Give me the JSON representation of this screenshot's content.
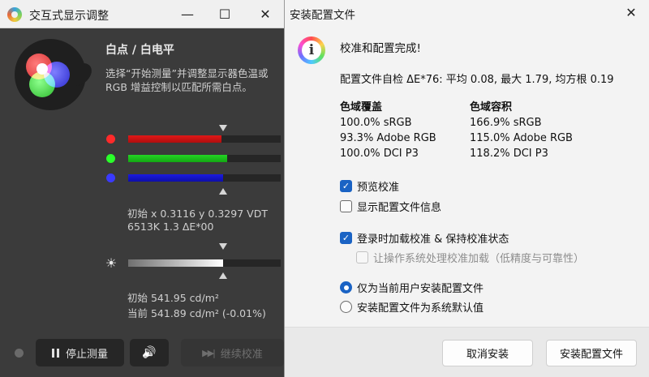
{
  "left_window": {
    "title": "交互式显示调整",
    "minimize_glyph": "—",
    "maximize_glyph": "☐",
    "close_glyph": "✕",
    "section_title": "白点 / 白电平",
    "description": "选择“开始测量”并调整显示器色温或\nRGB 增益控制以匹配所需白点。",
    "channels": [
      {
        "name": "red",
        "color": "#ff2a2a",
        "level_percent": 61
      },
      {
        "name": "green",
        "color": "#2aff2a",
        "level_percent": 65
      },
      {
        "name": "blue",
        "color": "#3a3aff",
        "level_percent": 62
      }
    ],
    "initial_xy": "初始 x 0.3116 y 0.3297 VDT",
    "initial_cct": "6513K 1.3 ΔE*00",
    "sun_icon": "☀",
    "luminance_level_percent": 62,
    "lum_initial": "初始 541.95 cd/m²",
    "lum_current": "当前 541.89 cd/m² (-0.01%)",
    "buttons": {
      "stop": "停止测量",
      "sound_icon": "🔊",
      "continue_icon": "▶▶|",
      "continue": "继续校准"
    }
  },
  "right_dialog": {
    "title": "安装配置文件",
    "close_glyph": "✕",
    "info_glyph": "i",
    "done_text": "校准和配置完成!",
    "selfcheck": "配置文件自检 ΔE*76: 平均 0.08, 最大 1.79, 均方根 0.19",
    "gamut_coverage": {
      "header": "色域覆盖",
      "rows": [
        "100.0% sRGB",
        "93.3% Adobe RGB",
        "100.0% DCI P3"
      ]
    },
    "gamut_volume": {
      "header": "色域容积",
      "rows": [
        "166.9% sRGB",
        "115.0% Adobe RGB",
        "118.2% DCI P3"
      ]
    },
    "checkboxes": {
      "preview": {
        "label": "预览校准",
        "checked": true
      },
      "show_info": {
        "label": "显示配置文件信息",
        "checked": false
      },
      "load_login": {
        "label": "登录时加载校准 & 保持校准状态",
        "checked": true
      },
      "os_handle": {
        "label": "让操作系统处理校准加载（低精度与可靠性）",
        "checked": false
      }
    },
    "check_glyph": "✓",
    "radios": {
      "user": {
        "label": "仅为当前用户安装配置文件",
        "selected": true
      },
      "system": {
        "label": "安装配置文件为系统默认值",
        "selected": false
      }
    },
    "buttons": {
      "cancel": "取消安装",
      "install": "安装配置文件"
    }
  }
}
